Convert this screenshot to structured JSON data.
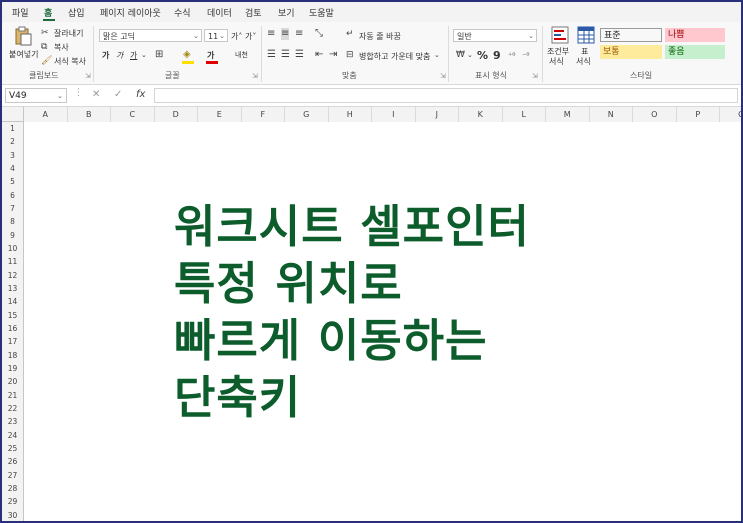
{
  "ribbon_tabs": [
    "파일",
    "홈",
    "삽입",
    "페이지 레이아웃",
    "수식",
    "데이터",
    "검토",
    "보기",
    "도움말"
  ],
  "active_tab": "홈",
  "clipboard": {
    "paste_label": "붙여넣기",
    "cut_label": "잘라내기",
    "copy_label": "복사",
    "format_painter_label": "서식 복사",
    "group_label": "클립보드"
  },
  "font": {
    "font_name": "맑은 고딕",
    "font_size": "11",
    "increase_label": "가˄",
    "decrease_label": "가˅",
    "bold": "가",
    "italic": "가",
    "underline": "가",
    "font_color_glyph": "가",
    "phonetic_label": "내천",
    "group_label": "글꼴"
  },
  "alignment": {
    "wrap_text_label": "자동 줄 바꿈",
    "merge_label": "병합하고 가운데 맞춤",
    "group_label": "맞춤"
  },
  "number": {
    "format": "일반",
    "percent": "%",
    "comma": "9",
    "group_label": "표시 형식"
  },
  "styles": {
    "conditional_label_1": "조건부",
    "conditional_label_2": "서식",
    "table_label_1": "표",
    "table_label_2": "서식",
    "cells": [
      {
        "label": "표준",
        "bg": "#ffffff",
        "color": "#000000"
      },
      {
        "label": "나쁨",
        "bg": "#ffc7ce",
        "color": "#9c0006"
      },
      {
        "label": "보통",
        "bg": "#ffeb9c",
        "color": "#9c5700"
      },
      {
        "label": "좋음",
        "bg": "#c6efce",
        "color": "#006100"
      }
    ],
    "group_label": "스타일"
  },
  "formula_bar": {
    "name_box": "V49",
    "cancel_glyph": "✕",
    "enter_glyph": "✓",
    "fx_label": "fx",
    "formula": ""
  },
  "columns": [
    "A",
    "B",
    "C",
    "D",
    "E",
    "F",
    "G",
    "H",
    "I",
    "J",
    "K",
    "L",
    "M",
    "N",
    "O",
    "P",
    "Q"
  ],
  "rows": [
    "1",
    "2",
    "3",
    "4",
    "5",
    "6",
    "7",
    "8",
    "9",
    "10",
    "11",
    "12",
    "13",
    "14",
    "15",
    "16",
    "17",
    "18",
    "19",
    "20",
    "21",
    "22",
    "23",
    "24",
    "25",
    "26",
    "27",
    "28",
    "29",
    "30"
  ],
  "overlay_title": [
    "워크시트 셀포인터",
    "특정 위치로",
    "빠르게 이동하는",
    "단축키"
  ],
  "colors": {
    "accent": "#1e6b3c",
    "title": "#0d5c2c",
    "frame": "#2a2f7a"
  }
}
